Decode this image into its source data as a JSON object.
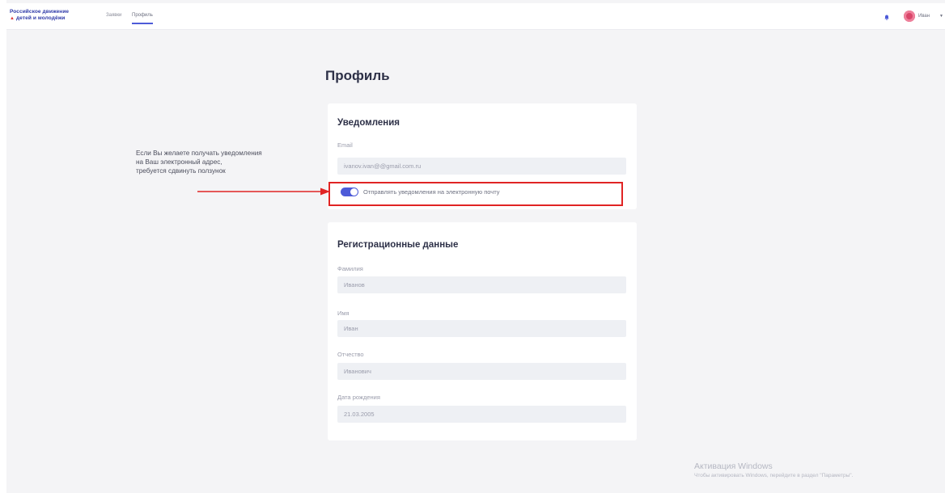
{
  "header": {
    "logo_line1": "Российское движение",
    "logo_line2": "детей и молодёжи",
    "nav": [
      {
        "label": "Заявки",
        "active": false
      },
      {
        "label": "Профиль",
        "active": true
      }
    ],
    "user_name": "Иван",
    "icons": {
      "bell": "bell-icon",
      "caret": "chevron-down-icon"
    }
  },
  "page": {
    "title": "Профиль"
  },
  "notifications": {
    "title": "Уведомления",
    "email_label": "Email",
    "email_value": "ivanov.ivan@@gmail.com.ru",
    "toggle_on": true,
    "toggle_label": "Отправлять уведомления на электронную почту"
  },
  "annotation": {
    "lines": [
      "Если Вы желаете получать уведомления",
      "на Ваш электронный адрес,",
      "требуется сдвинуть ползунок"
    ]
  },
  "registration": {
    "title": "Регистрационные данные",
    "fields": [
      {
        "label": "Фамилия",
        "value": "Иванов"
      },
      {
        "label": "Имя",
        "value": "Иван"
      },
      {
        "label": "Отчество",
        "value": "Иванович"
      },
      {
        "label": "Дата рождения",
        "value": "21.03.2005"
      }
    ]
  },
  "watermark": {
    "title": "Активация Windows",
    "subtitle": "Чтобы активировать Windows, перейдите в раздел \"Параметры\"."
  },
  "colors": {
    "accent": "#4d5bd8",
    "highlight": "#e02424",
    "background": "#f4f4f6"
  }
}
